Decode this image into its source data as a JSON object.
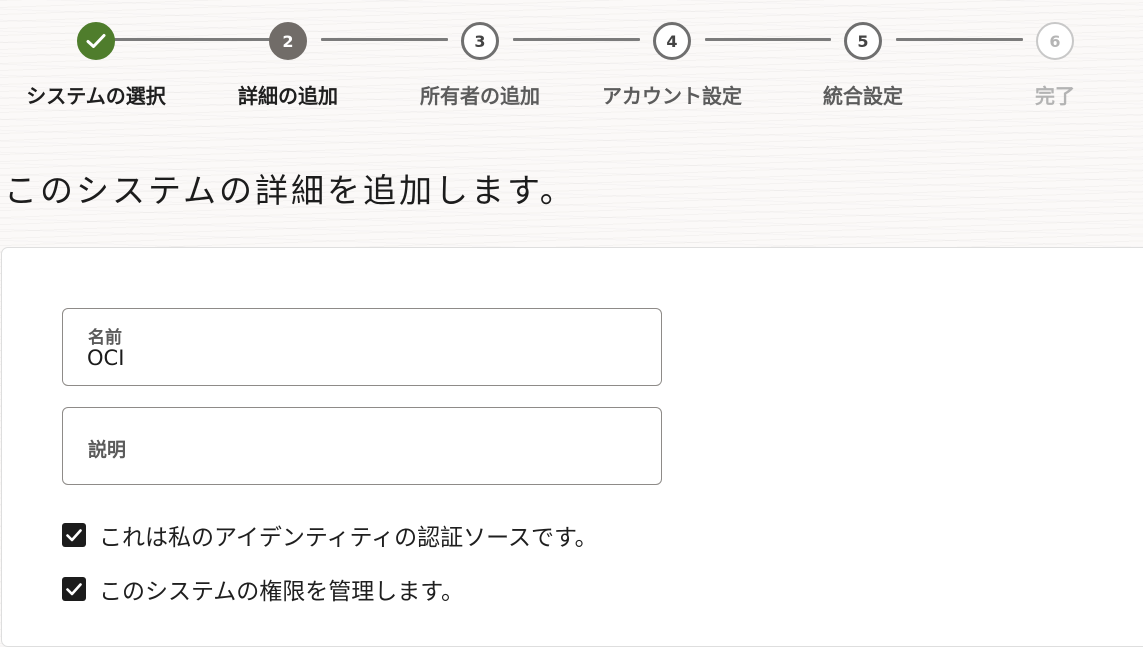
{
  "stepper": {
    "steps": [
      {
        "number": "1",
        "label": "システムの選択",
        "state": "done"
      },
      {
        "number": "2",
        "label": "詳細の追加",
        "state": "current"
      },
      {
        "number": "3",
        "label": "所有者の追加",
        "state": "upcoming"
      },
      {
        "number": "4",
        "label": "アカウント設定",
        "state": "upcoming"
      },
      {
        "number": "5",
        "label": "統合設定",
        "state": "upcoming"
      },
      {
        "number": "6",
        "label": "完了",
        "state": "disabled"
      }
    ],
    "done_icon": "checkmark-icon",
    "colors": {
      "done": "#4f7d2c",
      "current": "#716c68",
      "upcoming_border": "#6f6f6f",
      "disabled": "#c8c8c8"
    }
  },
  "page": {
    "title": "このシステムの詳細を追加します。"
  },
  "form": {
    "name": {
      "label": "名前",
      "value": "OCI"
    },
    "description": {
      "label": "説明",
      "value": ""
    },
    "checkboxes": [
      {
        "label": "これは私のアイデンティティの認証ソースです。",
        "checked": true,
        "icon": "checkmark-icon"
      },
      {
        "label": "このシステムの権限を管理します。",
        "checked": true,
        "icon": "checkmark-icon"
      }
    ]
  }
}
